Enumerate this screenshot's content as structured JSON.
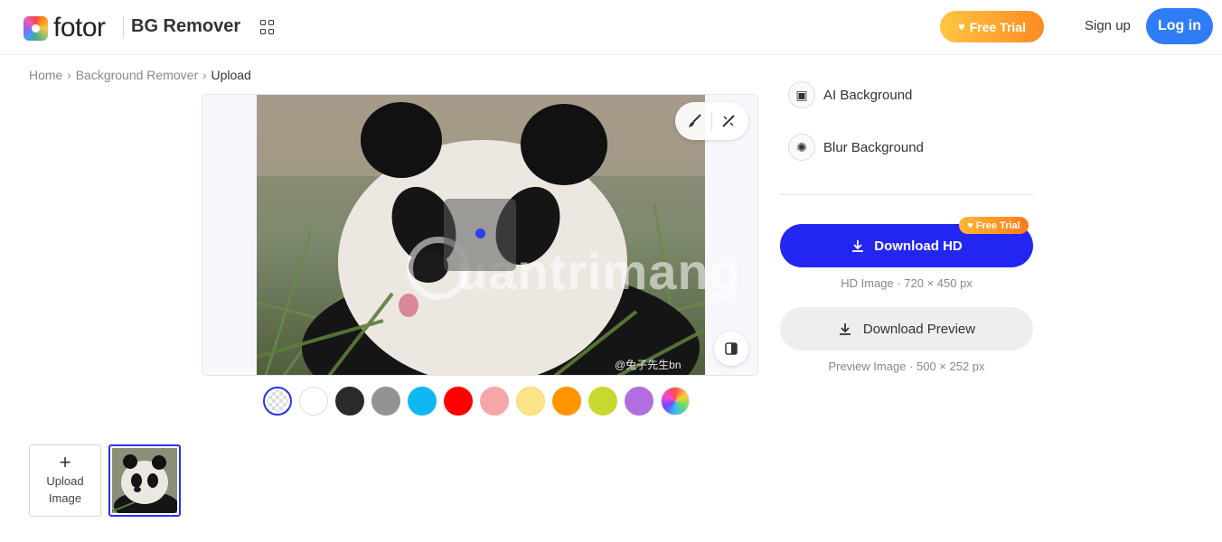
{
  "header": {
    "logo_text": "fotor",
    "product_name": "BG Remover",
    "free_trial_label": "Free Trial",
    "sign_up_label": "Sign up",
    "log_in_label": "Log in"
  },
  "breadcrumb": {
    "items": [
      "Home",
      "Background Remover",
      "Upload"
    ]
  },
  "preview": {
    "watermark": "uantrimang",
    "source_credit": "@兔子先生bn"
  },
  "swatches": [
    {
      "name": "transparent",
      "color": "transparent"
    },
    {
      "name": "white",
      "color": "#ffffff"
    },
    {
      "name": "black",
      "color": "#2b2b2b"
    },
    {
      "name": "gray",
      "color": "#939393"
    },
    {
      "name": "cyan",
      "color": "#0fb8f2"
    },
    {
      "name": "red",
      "color": "#ff0000"
    },
    {
      "name": "pink",
      "color": "#f6a6a6"
    },
    {
      "name": "light-yellow",
      "color": "#fbe38a"
    },
    {
      "name": "orange",
      "color": "#ff9500"
    },
    {
      "name": "lime",
      "color": "#c7d92e"
    },
    {
      "name": "purple",
      "color": "#b06ee0"
    },
    {
      "name": "rainbow",
      "color": "gradient"
    }
  ],
  "thumbnails": {
    "upload_label": "Upload Image"
  },
  "panel": {
    "ai_background_label": "AI Background",
    "blur_background_label": "Blur Background",
    "badge_label": "Free Trial",
    "download_hd_label": "Download HD",
    "hd_info": "HD Image · 720 × 450 px",
    "download_preview_label": "Download Preview",
    "preview_info": "Preview Image · 500 × 252 px"
  },
  "colors": {
    "primary": "#2326f3",
    "login": "#2f7df6",
    "trial_gradient_start": "#ffc642",
    "trial_gradient_end": "#ff8a23"
  }
}
